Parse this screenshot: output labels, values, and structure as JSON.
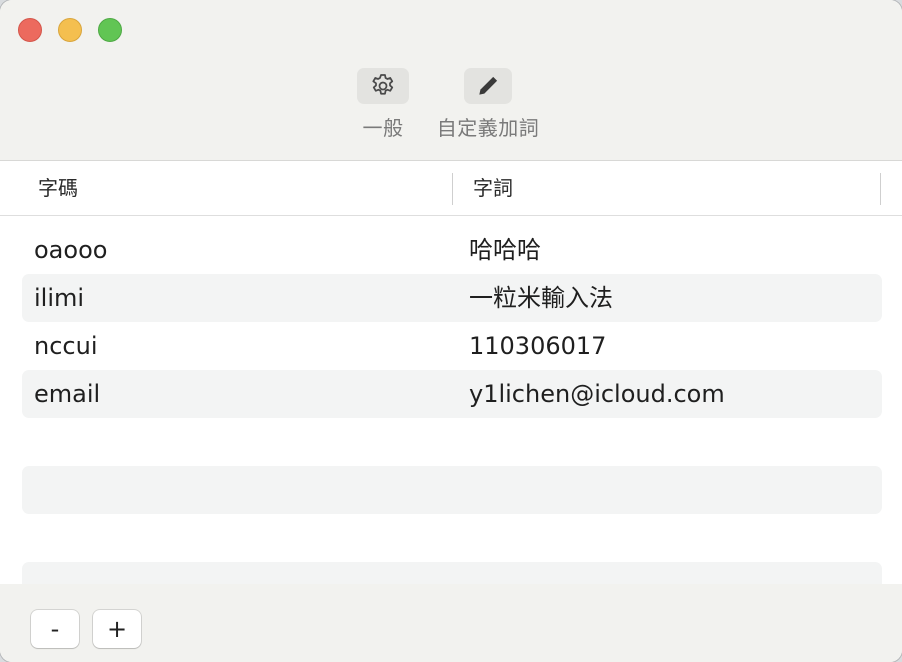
{
  "window": {
    "controls": [
      "close",
      "minimize",
      "zoom"
    ],
    "colors": {
      "close": "#ec6a5e",
      "minimize": "#f4bf4f",
      "zoom": "#61c554"
    }
  },
  "toolbar": {
    "items": [
      {
        "label": "一般",
        "icon": "gear-icon"
      },
      {
        "label": "自定義加詞",
        "icon": "pencil-icon"
      }
    ]
  },
  "table": {
    "columns": [
      "字碼",
      "字詞"
    ],
    "rows": [
      {
        "code": "oaooo",
        "word": "哈哈哈"
      },
      {
        "code": "ilimi",
        "word": "一粒米輸入法"
      },
      {
        "code": "nccui",
        "word": "110306017"
      },
      {
        "code": "email",
        "word": "y1lichen@icloud.com"
      }
    ]
  },
  "footer": {
    "remove_label": "-",
    "add_label": "+"
  }
}
